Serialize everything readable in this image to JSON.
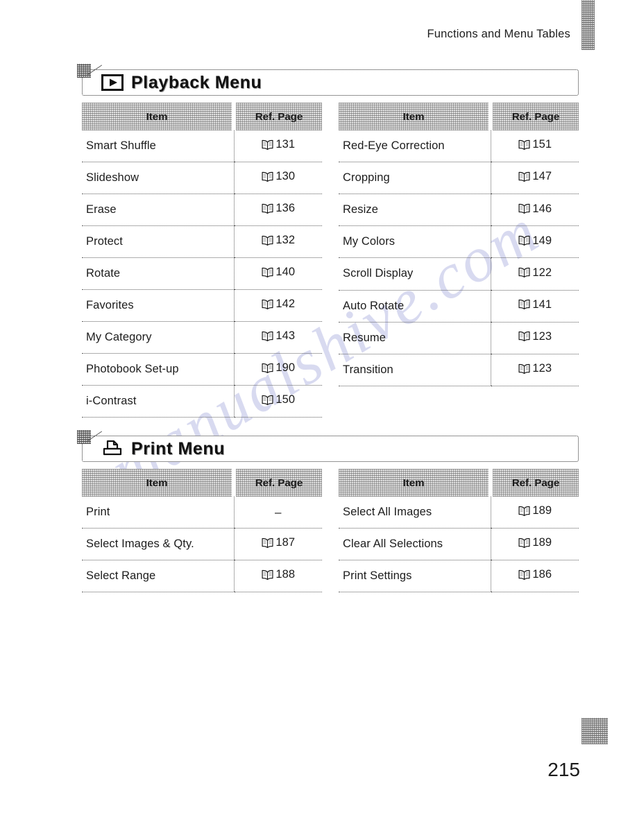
{
  "page": {
    "running_header": "Functions and Menu Tables",
    "page_number": "215",
    "watermark_text": "manualshive.com"
  },
  "sections": [
    {
      "id": "playback",
      "title": "Playback Menu",
      "icon": "playback-icon",
      "columns": {
        "item": "Item",
        "ref_page": "Ref. Page"
      },
      "left_rows": [
        {
          "item": "Smart Shuffle",
          "ref": "131",
          "has_book_icon": true
        },
        {
          "item": "Slideshow",
          "ref": "130",
          "has_book_icon": true
        },
        {
          "item": "Erase",
          "ref": "136",
          "has_book_icon": true
        },
        {
          "item": "Protect",
          "ref": "132",
          "has_book_icon": true
        },
        {
          "item": "Rotate",
          "ref": "140",
          "has_book_icon": true
        },
        {
          "item": "Favorites",
          "ref": "142",
          "has_book_icon": true
        },
        {
          "item": "My Category",
          "ref": "143",
          "has_book_icon": true
        },
        {
          "item": "Photobook Set-up",
          "ref": "190",
          "has_book_icon": true
        },
        {
          "item": "i-Contrast",
          "ref": "150",
          "has_book_icon": true
        }
      ],
      "right_rows": [
        {
          "item": "Red-Eye Correction",
          "ref": "151",
          "has_book_icon": true
        },
        {
          "item": "Cropping",
          "ref": "147",
          "has_book_icon": true
        },
        {
          "item": "Resize",
          "ref": "146",
          "has_book_icon": true
        },
        {
          "item": "My Colors",
          "ref": "149",
          "has_book_icon": true
        },
        {
          "item": "Scroll Display",
          "ref": "122",
          "has_book_icon": true
        },
        {
          "item": "Auto Rotate",
          "ref": "141",
          "has_book_icon": true
        },
        {
          "item": "Resume",
          "ref": "123",
          "has_book_icon": true
        },
        {
          "item": "Transition",
          "ref": "123",
          "has_book_icon": true
        }
      ]
    },
    {
      "id": "print",
      "title": "Print Menu",
      "icon": "printer-icon",
      "columns": {
        "item": "Item",
        "ref_page": "Ref. Page"
      },
      "left_rows": [
        {
          "item": "Print",
          "ref": "–",
          "has_book_icon": false
        },
        {
          "item": "Select Images & Qty.",
          "ref": "187",
          "has_book_icon": true
        },
        {
          "item": "Select Range",
          "ref": "188",
          "has_book_icon": true
        }
      ],
      "right_rows": [
        {
          "item": "Select All Images",
          "ref": "189",
          "has_book_icon": true
        },
        {
          "item": "Clear All Selections",
          "ref": "189",
          "has_book_icon": true
        },
        {
          "item": "Print Settings",
          "ref": "186",
          "has_book_icon": true
        }
      ]
    }
  ]
}
